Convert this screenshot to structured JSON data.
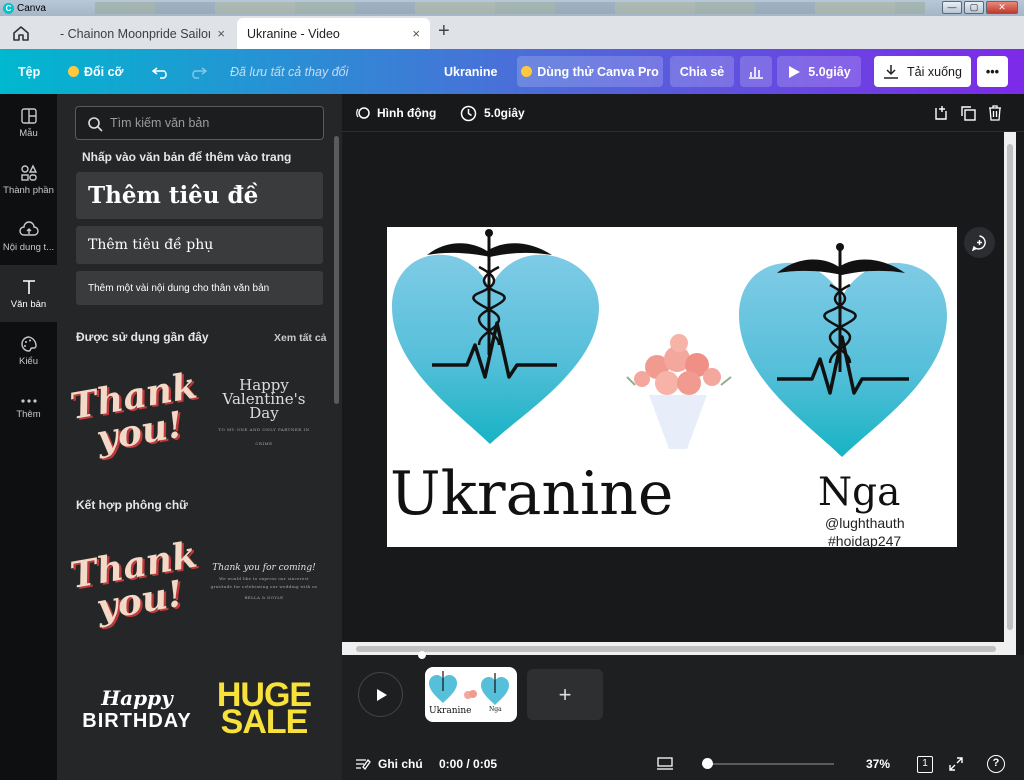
{
  "os": {
    "title": "Canva",
    "controls": [
      "—",
      "▢",
      "✕"
    ]
  },
  "browser": {
    "tabs": [
      {
        "label": "- Chainon Moonpride Sailorr",
        "active": false
      },
      {
        "label": "Ukranine - Video",
        "active": true
      }
    ],
    "new_tab": "+",
    "close": "×"
  },
  "header": {
    "file": "Tệp",
    "resize": "Đổi cỡ",
    "saved_status": "Đã lưu tất cả thay đổi",
    "design_title": "Ukranine",
    "try_pro": "Dùng thử Canva Pro",
    "share": "Chia sẻ",
    "duration": "5.0giây",
    "download": "Tải xuống",
    "more": "•••",
    "accent": "#7d2ae8"
  },
  "rail": [
    {
      "label": "Mẫu",
      "icon": "templates-icon"
    },
    {
      "label": "Thành phần",
      "icon": "elements-icon"
    },
    {
      "label": "Nội dung t...",
      "icon": "uploads-icon"
    },
    {
      "label": "Văn bản",
      "icon": "text-icon",
      "active": true
    },
    {
      "label": "Kiểu",
      "icon": "styles-icon"
    },
    {
      "label": "Thêm",
      "icon": "more-icon"
    }
  ],
  "panel": {
    "search_placeholder": "Tìm kiếm văn bản",
    "hint": "Nhấp vào văn bản để thêm vào trang",
    "add_heading": "Thêm tiêu đề",
    "add_subheading": "Thêm tiêu đề phụ",
    "add_body": "Thêm một vài nội dung cho thân văn bản",
    "recent_title": "Được sử dụng gần đây",
    "see_all": "Xem tất cả",
    "combos_title": "Kết hợp phông chữ",
    "thumbs": {
      "thank_a": "Thank",
      "thank_b": "you!",
      "val_a": "Happy",
      "val_b": "Valentine's Day",
      "val_c": "TO MY ONE AND ONLY PARTNER IN CRIME",
      "tfc_a": "Thank you for coming!",
      "tfc_b": "We would like to express our sincerest gratitude for celebrating our wedding with us",
      "tfc_c": "BELLA & DOYLE",
      "hb_a": "Happy",
      "hb_b": "BIRTHDAY",
      "hs_a": "HUGE",
      "hs_b": "SALE"
    }
  },
  "toolbar": {
    "animate": "Hình động",
    "duration": "5.0giây"
  },
  "slide": {
    "left_text": "Ukranine",
    "right_text": "Nga",
    "handle1": "@lughthauth",
    "handle2": "#hoidap247"
  },
  "timeline": {
    "clip_left": "Ukranine",
    "clip_right": "Nga",
    "add": "+",
    "notes": "Ghi chú",
    "time": "0:00 / 0:05",
    "zoom": "37%",
    "page": "1",
    "help": "?"
  }
}
